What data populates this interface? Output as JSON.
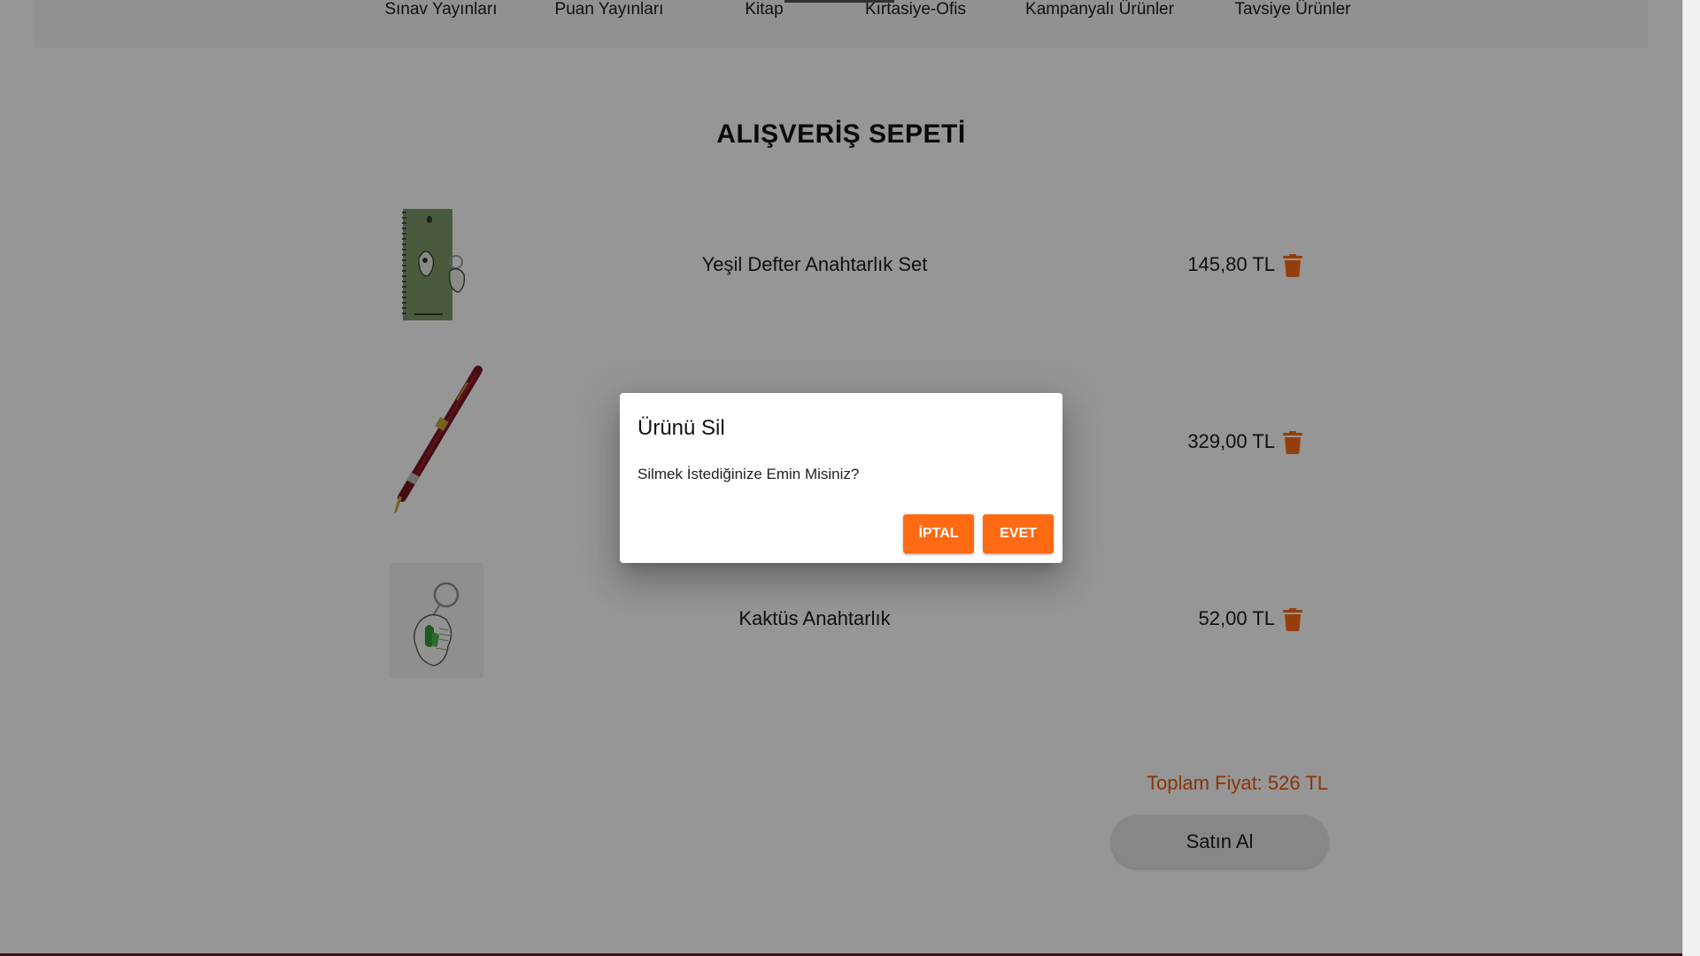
{
  "nav": {
    "items": [
      {
        "label": "Sınav Yayınları"
      },
      {
        "label": "Puan Yayınları"
      },
      {
        "label": "Kitap"
      },
      {
        "label": "Kırtasiye-Ofis"
      },
      {
        "label": "Kampanyalı Ürünler"
      },
      {
        "label": "Tavsiye Ürünler"
      }
    ]
  },
  "cart": {
    "title": "ALIŞVERİŞ SEPETİ",
    "items": [
      {
        "name": "Yeşil Defter Anahtarlık Set",
        "price": "145,80 TL",
        "image": "green-notebook-keychain-set"
      },
      {
        "name": "",
        "price": "329,00 TL",
        "image": "burgundy-fountain-pen"
      },
      {
        "name": "Kaktüs Anahtarlık",
        "price": "52,00 TL",
        "image": "cactus-keychain"
      }
    ],
    "delete_icon": "trash-icon",
    "total_label": "Toplam Fiyat: 526 TL",
    "buy_label": "Satın Al"
  },
  "dialog": {
    "title": "Ürünü Sil",
    "message": "Silmek İstediğinize Emin Misiniz?",
    "cancel_label": "İPTAL",
    "confirm_label": "EVET"
  },
  "colors": {
    "accent": "#ff6a13",
    "total_text": "#e85a0c",
    "overlay": "rgba(0,0,0,0.41)"
  }
}
